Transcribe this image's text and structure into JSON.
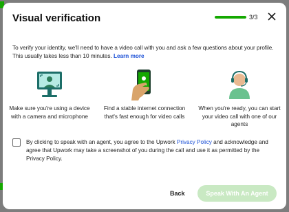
{
  "modal": {
    "title": "Visual verification",
    "progress_fraction": 1.0,
    "step_label": "3/3",
    "intro_text": "To verify your identity, we'll need to have a video call with you and ask a few questions about your profile. This usually takes less than 10 minutes.",
    "learn_more_label": "Learn more",
    "features": [
      {
        "icon": "computer-video-call-icon",
        "caption": "Make sure you're using a device with a camera and microphone"
      },
      {
        "icon": "phone-in-hand-icon",
        "caption": "Find a stable internet connection that's fast enough for video calls"
      },
      {
        "icon": "agent-headset-icon",
        "caption": "When you're ready, you can start your video call with one of our agents"
      }
    ],
    "consent": {
      "checked": false,
      "text_before": "By clicking to speak with an agent, you agree to the Upwork ",
      "link_label": "Privacy Policy",
      "text_after": " and acknowledge and agree that Upwork may take a screenshot of you during the call and use it as permitted by the Privacy Policy."
    },
    "back_label": "Back",
    "primary_label": "Speak With An Agent"
  },
  "colors": {
    "accent": "#14a800",
    "link": "#1a4fd6",
    "disabled_button": "#c9e9c3"
  }
}
